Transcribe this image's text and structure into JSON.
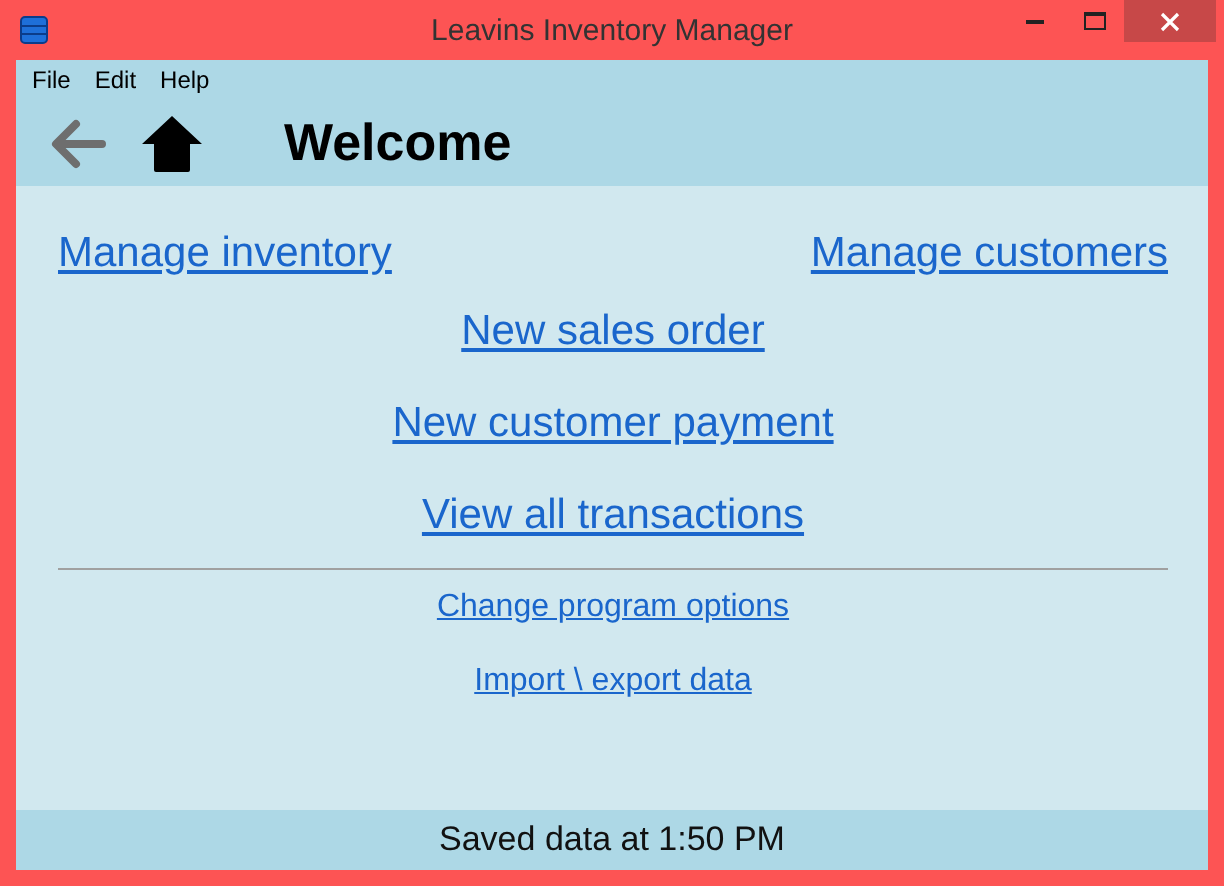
{
  "window": {
    "title": "Leavins Inventory Manager"
  },
  "menu": [
    "File",
    "Edit",
    "Help"
  ],
  "toolbar": {
    "back_disabled": true,
    "heading": "Welcome"
  },
  "top_links": [
    "Manage inventory",
    "Manage customers"
  ],
  "main_links": [
    "New sales order",
    "New customer payment",
    "View all transactions"
  ],
  "minor_links": [
    "Change program options",
    "Import \\ export data"
  ],
  "status_bar": "Saved data at 1:50 PM"
}
